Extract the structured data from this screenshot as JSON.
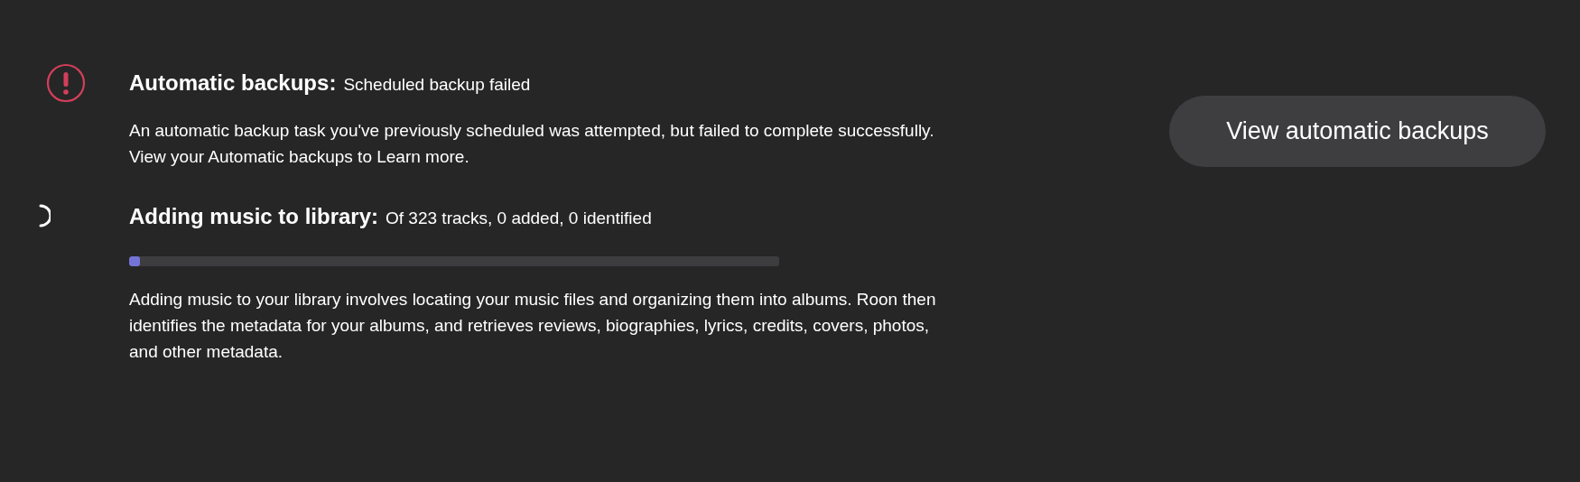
{
  "tasks": [
    {
      "kind": "error",
      "title": "Automatic backups:",
      "status": "Scheduled backup failed",
      "description": "An automatic backup task you've previously scheduled was attempted, but failed to complete successfully.\nView your Automatic backups to Learn more.",
      "button": "View automatic backups"
    },
    {
      "kind": "progress",
      "title": "Adding music to library:",
      "status": "Of 323 tracks, 0 added, 0 identified",
      "level": 0.017,
      "description": "Adding music to your library involves locating your music files and organizing them into albums. Roon then\nidentifies the metadata for your albums, and retrieves reviews, biographies, lyrics, credits, covers, photos,\nand other metadata."
    }
  ]
}
